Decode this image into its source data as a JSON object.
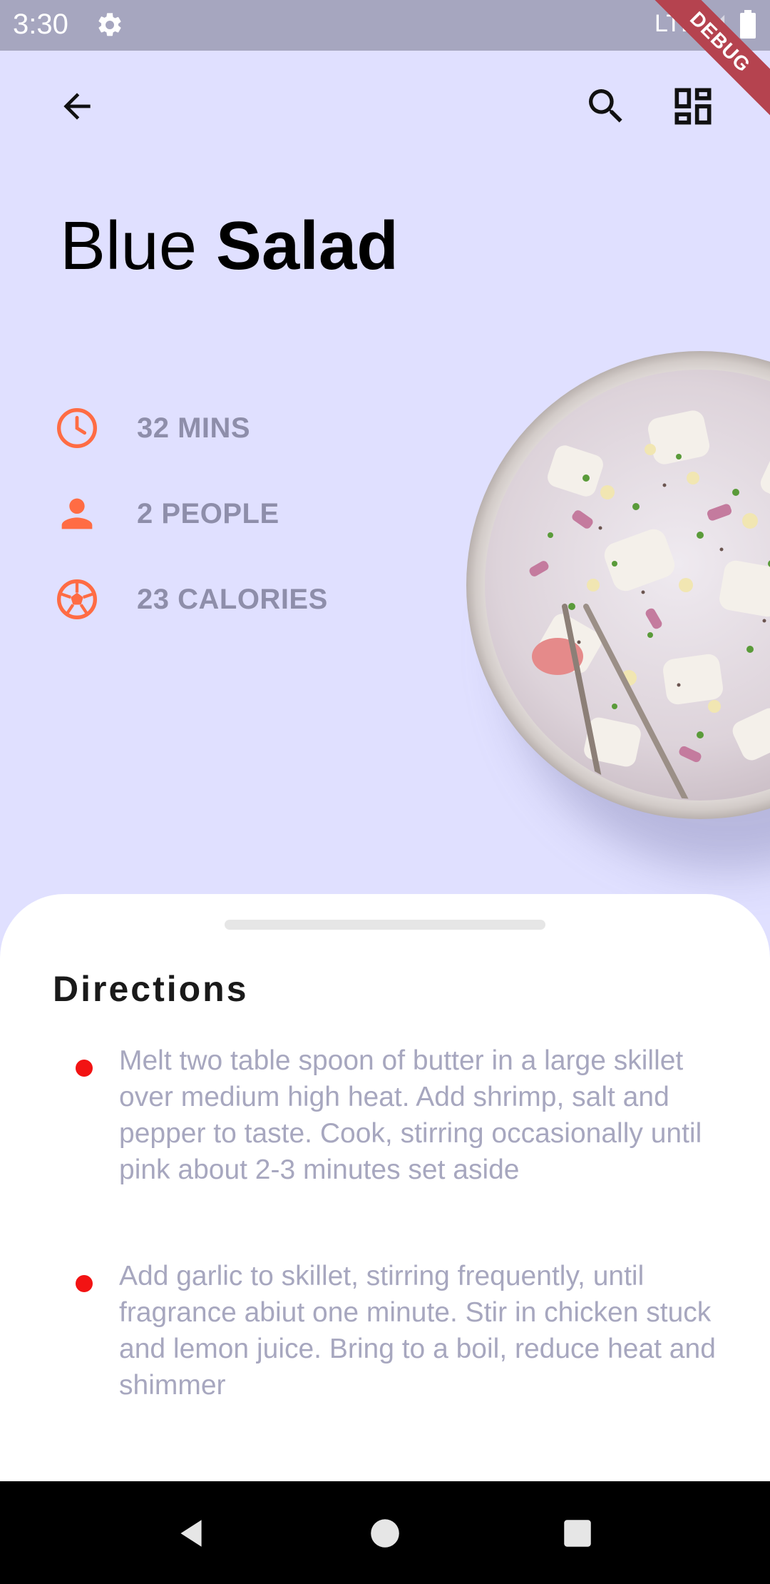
{
  "status_bar": {
    "time": "3:30",
    "network": "LTE",
    "debug_label": "DEBUG",
    "settings_icon": "gear-icon",
    "signal_icon": "signal-icon",
    "battery_icon": "battery-icon"
  },
  "app_bar": {
    "back_icon": "arrow-back-icon",
    "search_icon": "search-icon",
    "grid_icon": "dashboard-grid-icon"
  },
  "recipe": {
    "title_light": "Blue",
    "title_bold": "Salad",
    "info": [
      {
        "icon": "clock-icon",
        "label": "32 MINS"
      },
      {
        "icon": "person-icon",
        "label": "2 PEOPLE"
      },
      {
        "icon": "ball-icon",
        "label": "23 CALORIES"
      }
    ],
    "image": "salad-bowl-image"
  },
  "directions": {
    "title": "Directions",
    "steps": [
      "Melt two table spoon of butter in a large skillet over medium high heat. Add shrimp, salt and pepper to taste. Cook, stirring occasionally until pink about 2-3 minutes set aside",
      "Add garlic to skillet, stirring frequently, until fragrance abiut one minute. Stir in chicken stuck and lemon juice. Bring to a boil, reduce heat and shimmer"
    ]
  },
  "nav_bar": {
    "back_icon": "nav-back-icon",
    "home_icon": "nav-home-icon",
    "recents_icon": "nav-recents-icon"
  },
  "colors": {
    "background": "#e0e0ff",
    "accent": "#ff6c44",
    "info_text": "#8e8eaa",
    "bullet": "#f21313",
    "step_text": "#a7a7bf",
    "debug": "#b5434f"
  }
}
